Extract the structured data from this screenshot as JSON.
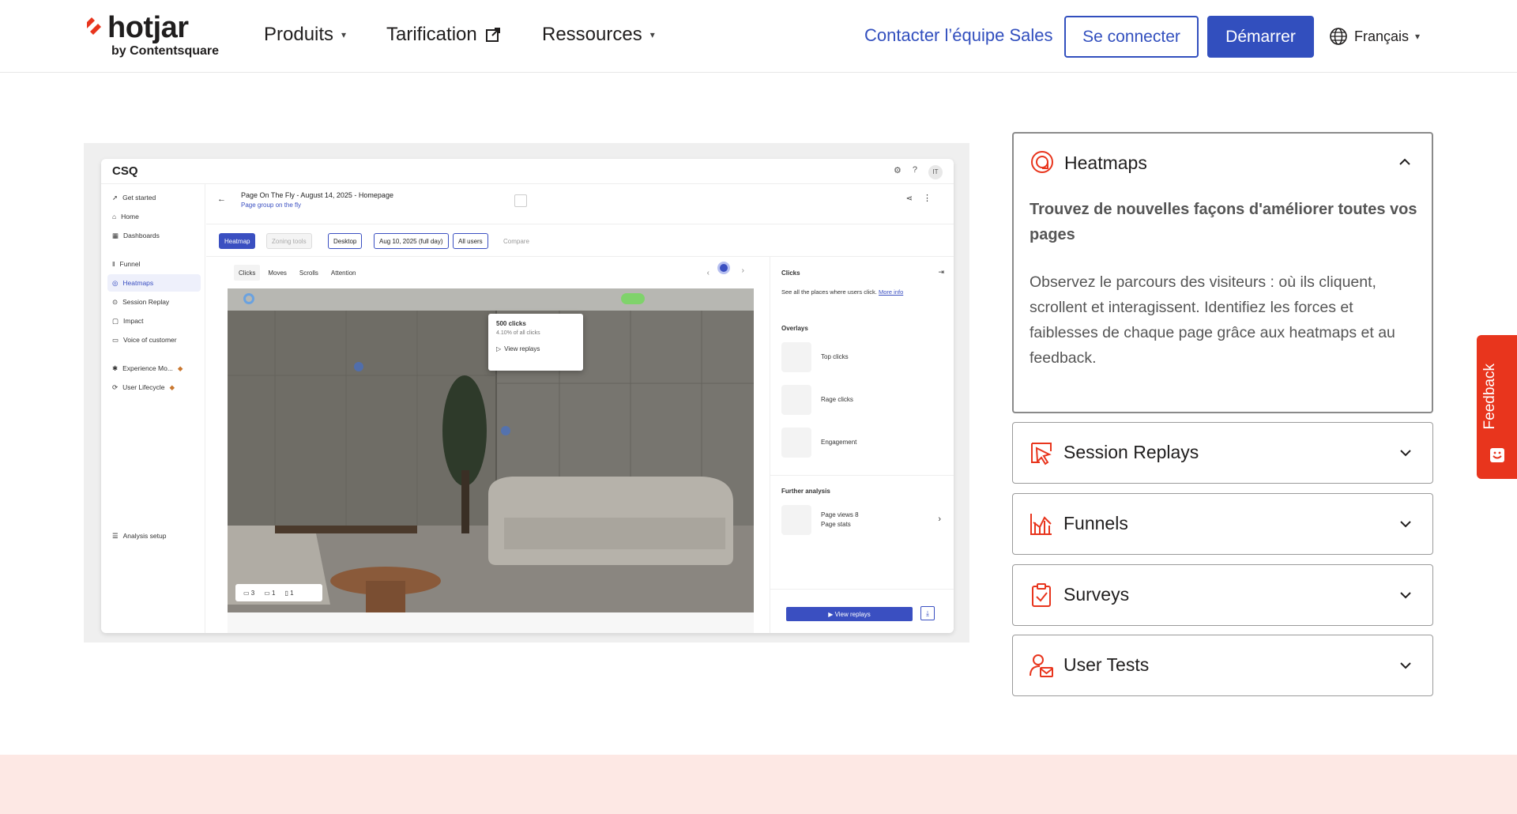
{
  "nav": {
    "logo_word": "hotjar",
    "logo_by": "by Contentsquare",
    "links": [
      {
        "label": "Produits",
        "caret": "⌄"
      },
      {
        "label": "Tarification"
      },
      {
        "label": "Ressources",
        "caret": "⌄"
      }
    ],
    "sales": "Contacter l’équipe Sales",
    "login": "Se connecter",
    "start": "Démarrer",
    "lang": "Français"
  },
  "screenshot": {
    "logo": "CSQ",
    "side_items": [
      "Get started",
      "Home",
      "Dashboards",
      "Funnel",
      "Heatmaps",
      "Session Replay",
      "Impact",
      "Voice of customer",
      "Experience Mo...",
      "User Lifecycle",
      "Analysis setup"
    ],
    "page_title": "Page On The Fly - August 14, 2025 - Homepage",
    "page_sub": "Page group on the fly",
    "filters": [
      "Heatmap",
      "Zoning tools",
      "Desktop",
      "Aug 10, 2025 (full day)",
      "All users",
      "Compare"
    ],
    "canvas_tabs": [
      "Clicks",
      "Moves",
      "Scrolls",
      "Attention"
    ],
    "popup": {
      "clicks": "500 clicks",
      "pct": "4.10% of all clicks",
      "action": "View replays"
    },
    "device_counts": [
      "3",
      "1",
      "1"
    ],
    "right": {
      "title": "Clicks",
      "desc": "See all the places where users click.",
      "more": "More info",
      "overlays": "Overlays",
      "overlay_items": [
        "Top clicks",
        "Rage clicks",
        "Engagement"
      ],
      "further": "Further analysis",
      "stats_line1": "Page views 8",
      "stats_line2": "Page stats",
      "view_replays": "View replays"
    }
  },
  "accordion": {
    "open": {
      "title": "Heatmaps",
      "lead": "Trouvez de nouvelles façons d'améliorer toutes vos pages",
      "body": "Observez le parcours des visiteurs : où ils cliquent, scrollent et interagissent. Identifiez les forces et faiblesses de chaque page grâce aux heatmaps et au feedback."
    },
    "items": [
      {
        "title": "Session Replays"
      },
      {
        "title": "Funnels"
      },
      {
        "title": "Surveys"
      },
      {
        "title": "User Tests"
      }
    ]
  },
  "feedback": "Feedback",
  "colors": {
    "brand_orange": "#e8351d",
    "brand_blue": "#324fbe"
  }
}
